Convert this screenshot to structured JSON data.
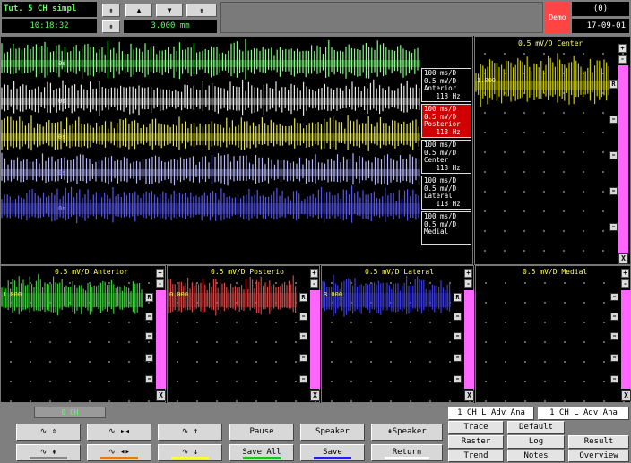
{
  "topbar": {
    "title": "Tut. 5 CH simpl",
    "time": "10:18:32",
    "distance": "3.000 mm",
    "demo": "Demo",
    "counter": "(0)",
    "date": "17-09-01",
    "buttons": {
      "up_double": "⇞",
      "up": "▲",
      "down": "▼",
      "down_double": "⇟",
      "step": "⇞"
    }
  },
  "main": {
    "labels": [
      {
        "line1": "100 ms/D",
        "line2": "0.5 mV/D",
        "line3": "Anterior",
        "line4": "   113 Hz"
      },
      {
        "line1": "100 ms/D",
        "line2": "0.5 mV/D",
        "line3": "Posterior",
        "line4": "   113 Hz"
      },
      {
        "line1": "100 ms/D",
        "line2": "0.5 mV/D",
        "line3": "Center",
        "line4": "   113 Hz"
      },
      {
        "line1": "100 ms/D",
        "line2": "0.5 mV/D",
        "line3": "Lateral",
        "line4": "   113 Hz"
      },
      {
        "line1": "100 ms/D",
        "line2": "0.5 mV/D",
        "line3": "Medial",
        "line4": ""
      }
    ],
    "trace_marks": [
      "0s",
      "0s",
      "0s",
      "0s",
      "0s"
    ]
  },
  "center_panel": {
    "title": "0.5 mV/D      Center",
    "value": "1.000",
    "r": "R",
    "plus": "+",
    "minus": "-",
    "x": "X"
  },
  "small_panels": [
    {
      "title": "0.5 mV/D   Anterior",
      "value": "1.000",
      "color": "#3ec93e"
    },
    {
      "title": "0.5 mV/D    Posterio",
      "value": "0.000",
      "color": "#d04848"
    },
    {
      "title": "0.5 mV/D    Lateral",
      "value": "3.000",
      "color": "#3b3bd8"
    },
    {
      "title": "0.5 mV/D     Medial",
      "value": "",
      "color": ""
    }
  ],
  "panel_controls": {
    "plus": "+",
    "minus": "-",
    "r": "R",
    "x": "X",
    "marker": "="
  },
  "bottom": {
    "green_label": "0 CH",
    "row1": [
      "∿ ⇕",
      "∿ ▸◂",
      "∿ ↑",
      "Pause",
      "Speaker",
      "⇞Speaker"
    ],
    "row2": [
      "∿ ⇞",
      "∿ ◂▸",
      "∿ ↓",
      "Save All",
      "Save",
      "Return"
    ],
    "right_top": [
      "1 CH L Adv Ana",
      "1 CH L Adv Ana"
    ],
    "right_row1": [
      "Trace",
      "Default"
    ],
    "right_row2": [
      "Raster",
      "Log",
      "Result"
    ],
    "right_row3": [
      "Trend",
      "Notes",
      "Overview"
    ]
  },
  "colors": {
    "anterior": "#3ec93e",
    "posterior": "#d04848",
    "center": "#c8c800",
    "lateral": "#3b3bd8",
    "medial": "#7f7f7f",
    "accent_green": "#5fff5f",
    "pink": "#ff66ff"
  }
}
